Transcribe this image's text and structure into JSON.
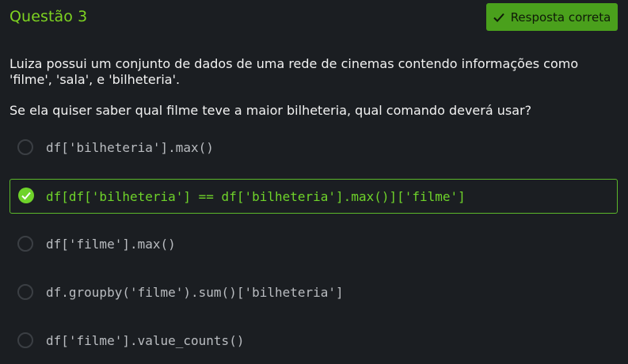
{
  "question": {
    "title": "Questão 3",
    "badge_label": "Resposta correta",
    "badge_icon": "check-icon",
    "statement": "Luiza possui um conjunto de dados de uma rede de cinemas contendo informações como 'filme', 'sala', e 'bilheteria'.",
    "prompt": "Se ela quiser saber qual filme teve a maior bilheteria, qual comando deverá usar?"
  },
  "options": [
    {
      "code": "df['bilheteria'].max()",
      "selected": false
    },
    {
      "code": "df[df['bilheteria'] == df['bilheteria'].max()]['filme']",
      "selected": true
    },
    {
      "code": "df['filme'].max()",
      "selected": false
    },
    {
      "code": "df.groupby('filme').sum()['bilheteria']",
      "selected": false
    },
    {
      "code": "df['filme'].value_counts()",
      "selected": false
    }
  ],
  "colors": {
    "background": "#1b1e22",
    "accent_green": "#7ed321",
    "badge_bg": "#4aa01c",
    "selected_border": "#5cb82a",
    "text": "#f2f2f2",
    "code_text": "#b9bcc0"
  }
}
